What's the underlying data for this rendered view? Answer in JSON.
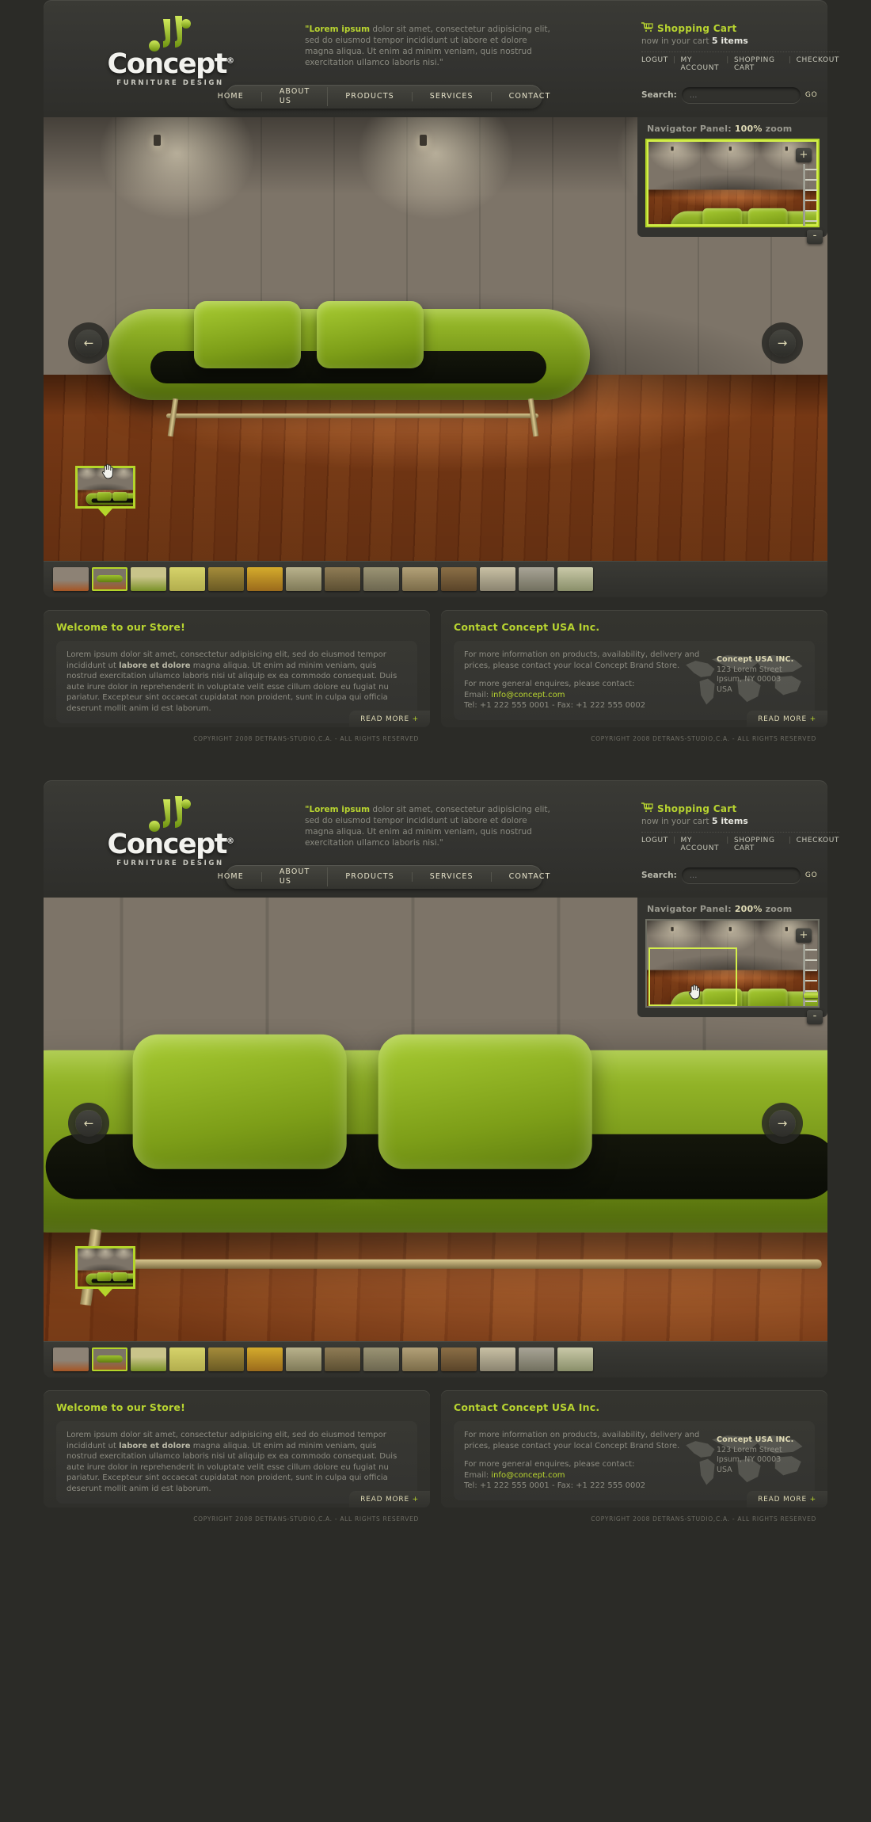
{
  "brand": {
    "name": "Concept",
    "registered": "®",
    "subtitle": "FURNITURE DESIGN"
  },
  "header": {
    "tagline_lead": "\"Lorem ipsum",
    "tagline_rest": " dolor sit amet, consectetur adipisicing elit, sed do eiusmod tempor incididunt ut labore et dolore magna aliqua. Ut enim ad minim veniam, quis nostrud exercitation ullamco laboris nisi.\"",
    "cart": {
      "icon": "shopping-cart-icon",
      "title": "Shopping Cart",
      "now_label": "now in your cart",
      "items": "5 items",
      "links": [
        "LOGUT",
        "MY ACCOUNT",
        "SHOPPING CART",
        "CHECKOUT"
      ]
    },
    "nav": [
      "HOME",
      "ABOUT US",
      "PRODUCTS",
      "SERVICES",
      "CONTACT"
    ],
    "search": {
      "label": "Search:",
      "placeholder": "...",
      "value": "",
      "go": "GO"
    }
  },
  "viewer_top": {
    "navigator": {
      "label": "Navigator Panel:",
      "zoom": "100%",
      "zoom_word": "zoom",
      "plus": "+",
      "minus": "-"
    },
    "arrow_prev": "←",
    "arrow_next": "→"
  },
  "viewer_bottom": {
    "navigator": {
      "label": "Navigator Panel:",
      "zoom": "200%",
      "zoom_word": "zoom",
      "plus": "+",
      "minus": "-"
    },
    "arrow_prev": "←",
    "arrow_next": "→"
  },
  "thumbnails": [
    {
      "name": "chaise-lounge",
      "selected": false
    },
    {
      "name": "green-sofa",
      "selected": true
    },
    {
      "name": "day-bed",
      "selected": false
    },
    {
      "name": "yellow-room",
      "selected": false
    },
    {
      "name": "olive-sofa",
      "selected": false
    },
    {
      "name": "tan-sofa",
      "selected": false
    },
    {
      "name": "cream-chair",
      "selected": false
    },
    {
      "name": "brown-armchair",
      "selected": false
    },
    {
      "name": "lounge-chair",
      "selected": false
    },
    {
      "name": "leather-sofa",
      "selected": false
    },
    {
      "name": "wood-bench",
      "selected": false
    },
    {
      "name": "white-bed",
      "selected": false
    },
    {
      "name": "grey-sofa",
      "selected": false
    },
    {
      "name": "blue-room",
      "selected": false
    }
  ],
  "welcome": {
    "heading": "Welcome to our Store!",
    "text_1": "Lorem ipsum dolor sit amet, consectetur adipisicing elit, sed do eiusmod tempor incididunt ut ",
    "text_bold": "labore et dolore",
    "text_2": " magna aliqua. Ut enim ad minim veniam, quis nostrud exercitation ullamco laboris nisi ut aliquip ex ea commodo consequat. Duis aute irure dolor in reprehenderit in voluptate velit esse cillum dolore eu fugiat nu pariatur. Excepteur sint occaecat cupidatat non proident, sunt in culpa qui officia deserunt mollit anim id est laborum.",
    "read_more": "READ MORE",
    "read_more_plus": "+"
  },
  "contact": {
    "heading": "Contact Concept USA Inc.",
    "para_1": "For more information on products, availability, delivery and prices, please contact your local Concept Brand Store.",
    "para_2": "For more general enquires, please contact:",
    "email_label": "Email:",
    "email": "info@concept.com",
    "phone_line": "Tel: +1 222 555 0001  -  Fax: +1 222 555 0002",
    "company": "Concept USA INC.",
    "address_1": "123 Lorem Street",
    "address_2": "Ipsum, NY 00003",
    "address_3": "USA",
    "read_more": "READ MORE",
    "read_more_plus": "+"
  },
  "footer": {
    "copyright": "COPYRIGHT 2008 DETRANS-STUDIO,C.A. - ALL RIGHTS RESERVED"
  },
  "colors": {
    "accent_green": "#b8d430",
    "bg_dark": "#2b2b27",
    "panel": "#34342f",
    "text_muted": "#8d8c82",
    "cream": "#ded9b4"
  }
}
